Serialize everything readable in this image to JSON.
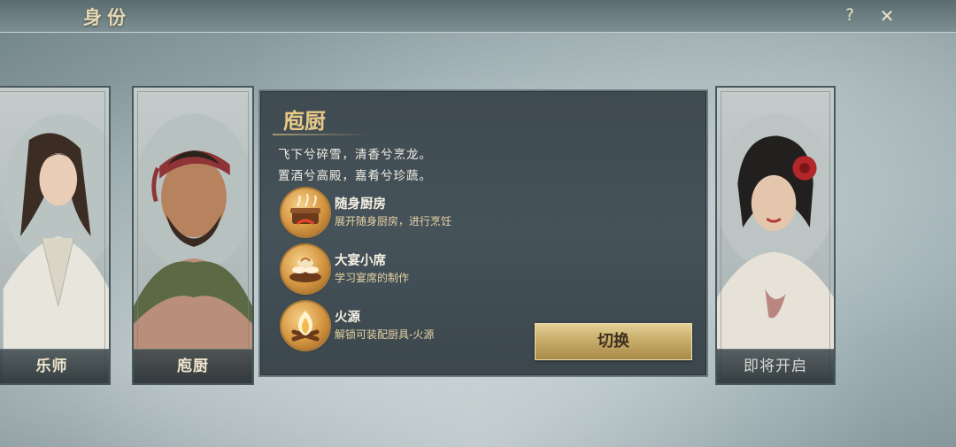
{
  "header": {
    "title": "身份",
    "help_label": "?",
    "close_label": "✕"
  },
  "cards": [
    {
      "name": "乐师",
      "status": "available",
      "icon": "musician-portrait"
    },
    {
      "name": "庖厨",
      "status": "selected",
      "icon": "cook-portrait"
    },
    {
      "name": "即将开启",
      "status": "locked",
      "icon": "lady-portrait"
    }
  ],
  "detail": {
    "title": "庖厨",
    "description": [
      "飞下兮碎雪，清香兮烹龙。",
      "置酒兮高殿，嘉肴兮珍蔬。"
    ],
    "skills": [
      {
        "name": "随身厨房",
        "desc": "展开随身厨房，进行烹饪",
        "icon": "cooking-pot-icon"
      },
      {
        "name": "大宴小席",
        "desc": "学习宴席的制作",
        "icon": "banquet-dishes-icon"
      },
      {
        "name": "火源",
        "desc": "解锁可装配厨具-火源",
        "icon": "campfire-icon"
      }
    ],
    "switch_label": "切换"
  },
  "colors": {
    "accent_gold": "#e9c989",
    "panel_bg": "#424e54",
    "button_gold": "#c9ad6a"
  }
}
